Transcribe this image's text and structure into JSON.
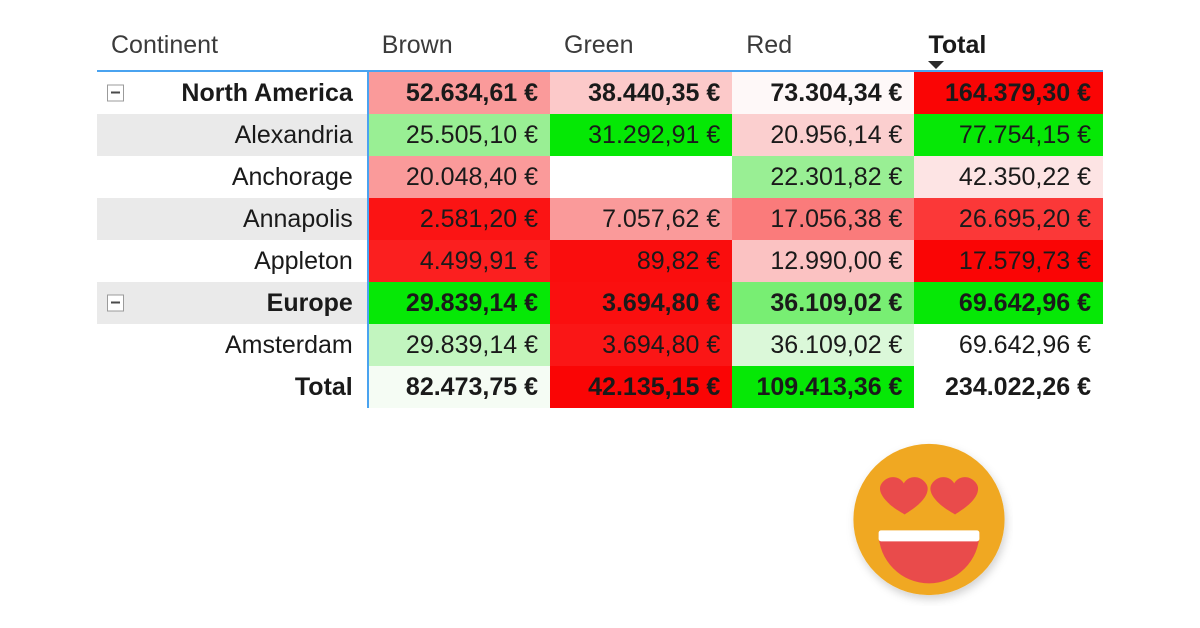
{
  "table": {
    "columns": [
      {
        "key": "rowhdr",
        "label": "Continent",
        "align": "left",
        "bold": false
      },
      {
        "key": "brown",
        "label": "Brown",
        "align": "left",
        "bold": false
      },
      {
        "key": "green",
        "label": "Green",
        "align": "left",
        "bold": false
      },
      {
        "key": "red",
        "label": "Red",
        "align": "left",
        "bold": false
      },
      {
        "key": "total",
        "label": "Total",
        "align": "left",
        "bold": true,
        "sort": "descending"
      }
    ],
    "rows": [
      {
        "label": "North America",
        "type": "group",
        "expander": "collapse-minus-icon",
        "stripe": false,
        "cells": [
          {
            "value": "52.634,61 €",
            "bg": "#fa9a9a"
          },
          {
            "value": "38.440,35 €",
            "bg": "#fcc9c9"
          },
          {
            "value": "73.304,34 €",
            "bg": "#fef8f8"
          },
          {
            "value": "164.379,30 €",
            "bg": "#fa0505"
          }
        ]
      },
      {
        "label": "Alexandria",
        "type": "detail",
        "stripe": true,
        "cells": [
          {
            "value": "25.505,10 €",
            "bg": "#99ef94"
          },
          {
            "value": "31.292,91 €",
            "bg": "#05e805"
          },
          {
            "value": "20.956,14 €",
            "bg": "#fbcfcf"
          },
          {
            "value": "77.754,15 €",
            "bg": "#06e806"
          }
        ]
      },
      {
        "label": "Anchorage",
        "type": "detail",
        "stripe": false,
        "cells": [
          {
            "value": "20.048,40 €",
            "bg": "#fa9a9a"
          },
          {
            "value": "",
            "bg": "#ffffff"
          },
          {
            "value": "22.301,82 €",
            "bg": "#99ef94"
          },
          {
            "value": "42.350,22 €",
            "bg": "#fde4e4"
          }
        ]
      },
      {
        "label": "Annapolis",
        "type": "detail",
        "stripe": true,
        "cells": [
          {
            "value": "2.581,20 €",
            "bg": "#fb1414"
          },
          {
            "value": "7.057,62 €",
            "bg": "#fa9a9a"
          },
          {
            "value": "17.056,38 €",
            "bg": "#fa7b7b"
          },
          {
            "value": "26.695,20 €",
            "bg": "#fb3838"
          }
        ]
      },
      {
        "label": "Appleton",
        "type": "detail",
        "stripe": false,
        "cells": [
          {
            "value": "4.499,91 €",
            "bg": "#fb1f1f"
          },
          {
            "value": "89,82 €",
            "bg": "#fa0d0d"
          },
          {
            "value": "12.990,00 €",
            "bg": "#fbc2c2"
          },
          {
            "value": "17.579,73 €",
            "bg": "#fa0505"
          }
        ]
      },
      {
        "label": "Europe",
        "type": "group",
        "expander": "collapse-minus-icon",
        "stripe": true,
        "cells": [
          {
            "value": "29.839,14 €",
            "bg": "#06e806"
          },
          {
            "value": "3.694,80 €",
            "bg": "#fa0f0f"
          },
          {
            "value": "36.109,02 €",
            "bg": "#78ee73"
          },
          {
            "value": "69.642,96 €",
            "bg": "#06e806"
          }
        ]
      },
      {
        "label": "Amsterdam",
        "type": "detail",
        "stripe": false,
        "cells": [
          {
            "value": "29.839,14 €",
            "bg": "#c2f5bf"
          },
          {
            "value": "3.694,80 €",
            "bg": "#fa1616"
          },
          {
            "value": "36.109,02 €",
            "bg": "#dbf8d9"
          },
          {
            "value": "69.642,96 €",
            "bg": "#ffffff"
          }
        ]
      },
      {
        "label": "Total",
        "type": "grandtotal",
        "stripe": false,
        "cells": [
          {
            "value": "82.473,75 €",
            "bg": "#f5fcf4"
          },
          {
            "value": "42.135,15 €",
            "bg": "#fa0505"
          },
          {
            "value": "109.413,36 €",
            "bg": "#06e806"
          },
          {
            "value": "234.022,26 €",
            "bg": "#ffffff"
          }
        ]
      }
    ]
  },
  "emoji": {
    "name": "smiling-face-with-heart-eyes-emoji",
    "face_color": "#f0a821",
    "heart_color": "#e94b4b",
    "mouth_color": "#e94b4b",
    "teeth_color": "#ffffff"
  }
}
